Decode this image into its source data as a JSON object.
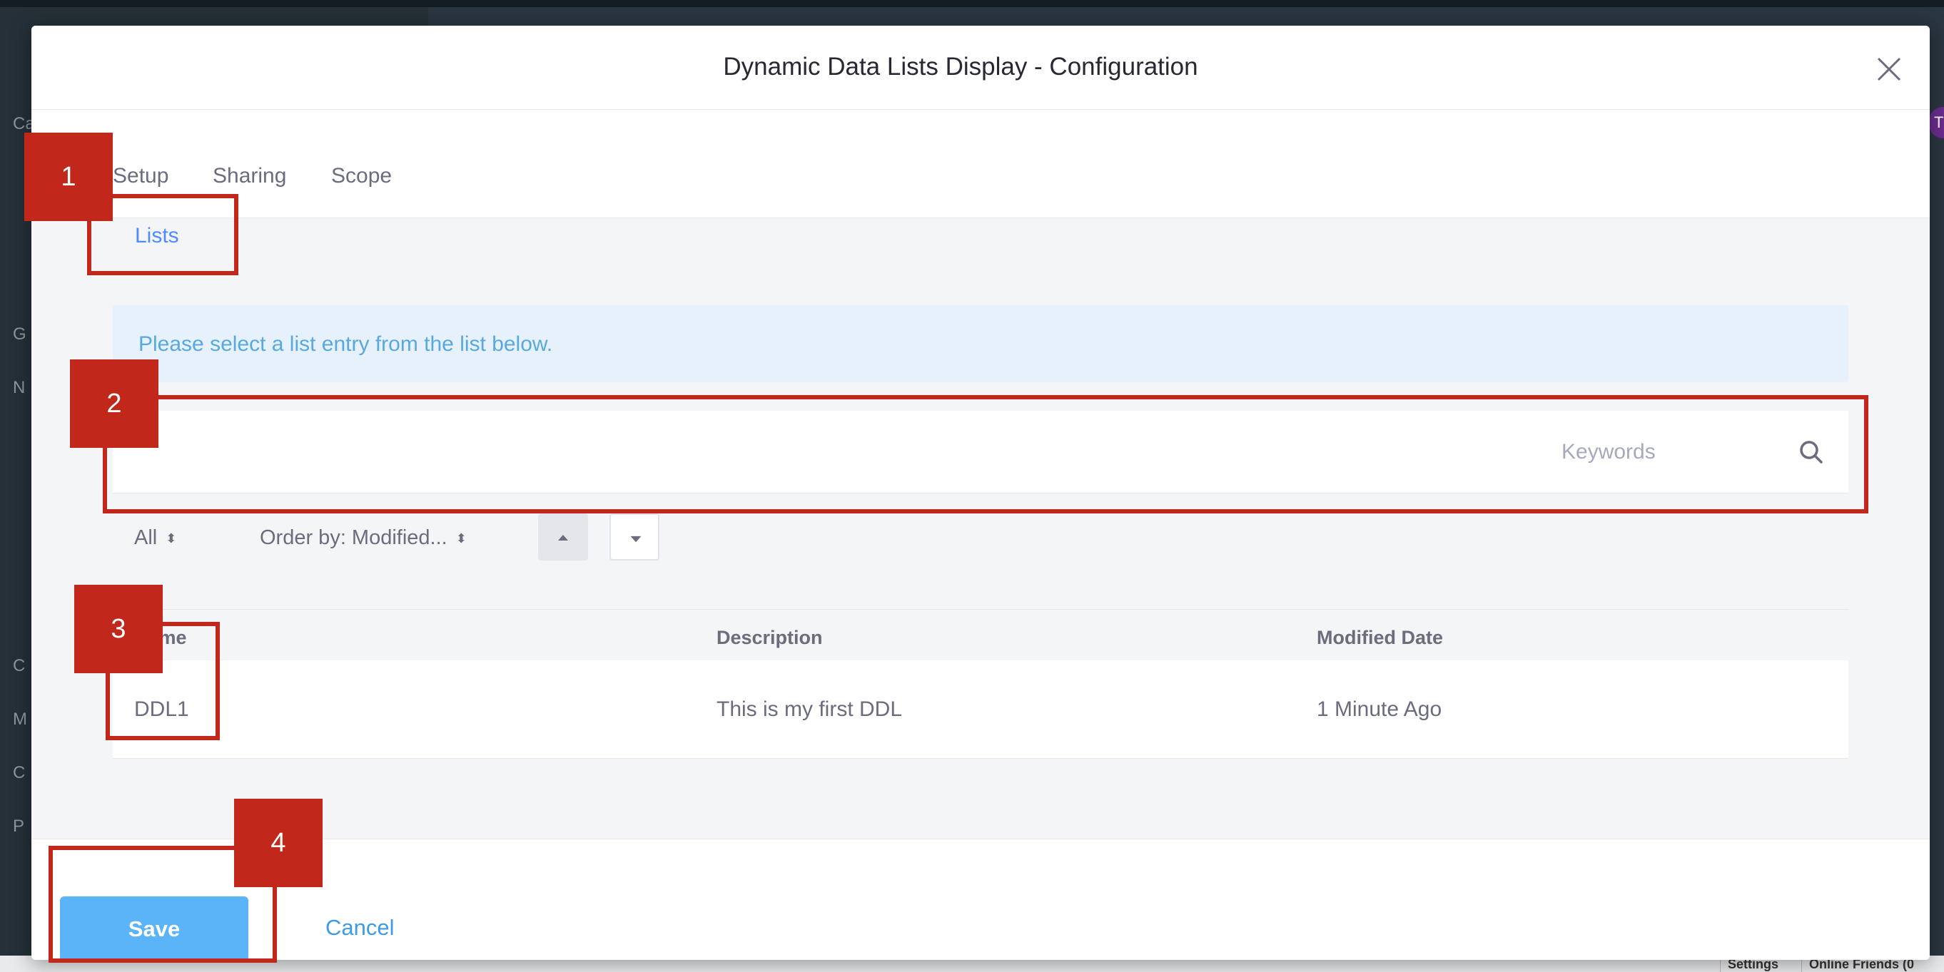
{
  "modal": {
    "title": "Dynamic Data Lists Display - Configuration",
    "close_icon": "close-icon"
  },
  "tabs": [
    {
      "label": "Setup"
    },
    {
      "label": "Sharing"
    },
    {
      "label": "Scope"
    }
  ],
  "subtab": {
    "label": "Lists"
  },
  "info": {
    "text": "Please select a list entry from the list below."
  },
  "search": {
    "placeholder": "Keywords",
    "value": "",
    "icon": "search-icon"
  },
  "filters": {
    "all_label": "All",
    "order_label": "Order by: Modified...",
    "sort_asc_icon": "caret-up-icon",
    "sort_desc_icon": "caret-down-icon"
  },
  "table": {
    "columns": [
      "Name",
      "Description",
      "Modified Date"
    ],
    "rows": [
      {
        "name": "DDL1",
        "description": "This is my first DDL",
        "modified": "1 Minute Ago"
      }
    ]
  },
  "footer": {
    "save_label": "Save",
    "cancel_label": "Cancel"
  },
  "annotations": [
    {
      "label": "1"
    },
    {
      "label": "2"
    },
    {
      "label": "3"
    },
    {
      "label": "4"
    }
  ],
  "background": {
    "bottom_buttons": [
      "Settings",
      "Online Friends (0"
    ],
    "avatar_initial": "T",
    "sidebar_letters": [
      "Ca",
      "G",
      "N",
      "C",
      "M",
      "C",
      "P"
    ]
  },
  "colors": {
    "accent": "#0b5fff",
    "save_button": "#5ab4f7",
    "annotation": "#c1271b",
    "info_bg": "#e6f1fb"
  }
}
